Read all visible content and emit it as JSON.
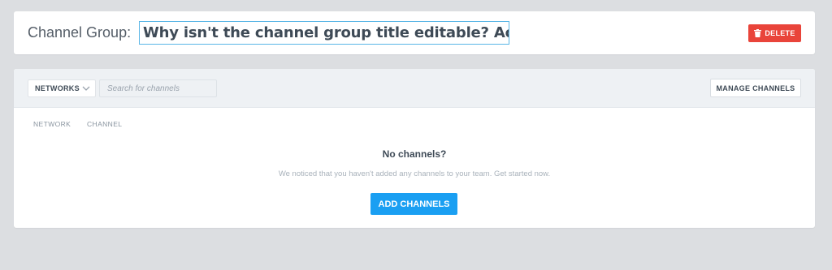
{
  "header": {
    "title_prefix": "Channel Group:",
    "title_value": "Why isn't the channel group title editable? Actually, it is.",
    "delete_label": "DELETE",
    "delete_icon": "trash-icon"
  },
  "toolbar": {
    "networks_label": "NETWORKS",
    "search_placeholder": "Search for channels",
    "manage_label": "MANAGE CHANNELS"
  },
  "table": {
    "columns": [
      "NETWORK",
      "CHANNEL"
    ]
  },
  "empty_state": {
    "title": "No channels?",
    "description": "We noticed that you haven't added any channels to your team. Get started now.",
    "button_label": "ADD CHANNELS"
  },
  "colors": {
    "background": "#dcdee1",
    "danger": "#e9443a",
    "primary": "#1a9ff2",
    "toolbar_bg": "#eef1f4",
    "focus_border": "#5ab6e6"
  }
}
